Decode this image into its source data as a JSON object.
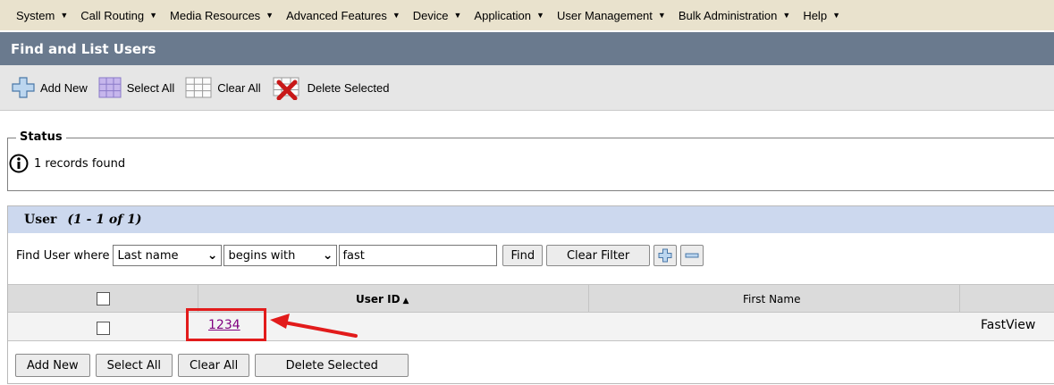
{
  "menu": [
    {
      "label": "System"
    },
    {
      "label": "Call Routing"
    },
    {
      "label": "Media Resources"
    },
    {
      "label": "Advanced Features"
    },
    {
      "label": "Device"
    },
    {
      "label": "Application"
    },
    {
      "label": "User Management"
    },
    {
      "label": "Bulk Administration"
    },
    {
      "label": "Help"
    }
  ],
  "page_title": "Find and List Users",
  "toolbar": {
    "add_new": "Add New",
    "select_all": "Select All",
    "clear_all": "Clear All",
    "delete_selected": "Delete Selected"
  },
  "status": {
    "legend": "Status",
    "message": "1 records found"
  },
  "panel": {
    "title": "User",
    "count": "(1 - 1 of 1)"
  },
  "filter": {
    "label": "Find User where",
    "field": "Last name",
    "operator": "begins with",
    "value": "fast",
    "find_button": "Find",
    "clear_filter_button": "Clear Filter",
    "add_icon": "plus-icon",
    "remove_icon": "minus-icon"
  },
  "table": {
    "columns": [
      "User ID",
      "First Name"
    ],
    "rows": [
      {
        "user_id": "1234",
        "first_name": "FastView"
      }
    ]
  },
  "bottom_buttons": {
    "add_new": "Add New",
    "select_all": "Select All",
    "clear_all": "Clear All",
    "delete_selected": "Delete Selected"
  },
  "colors": {
    "menubar": "#e9e2cd",
    "titlebar": "#6a7a8e",
    "panel_header": "#ccd8ee",
    "highlight": "#e21b1b",
    "link": "#800080"
  }
}
